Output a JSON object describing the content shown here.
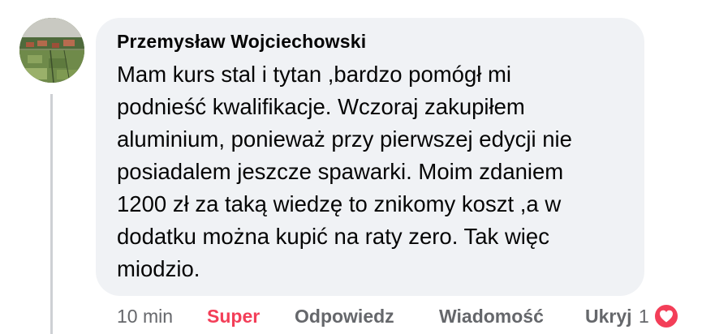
{
  "comment": {
    "author": "Przemysław Wojciechowski",
    "text": "Mam kurs stal i tytan ,bardzo pomógł mi\npodnieść kwalifikacje.  Wczoraj zakupiłem\naluminium, ponieważ przy pierwszej edycji nie\nposiadalem jeszcze spawarki. Moim zdaniem\n1200 zł za taką wiedzę to znikomy koszt ,a w\ndodatku można kupić na raty zero. Tak więc\nmiodzio."
  },
  "actions": {
    "time": "10 min",
    "reaction_label": "Super",
    "reply_label": "Odpowiedz",
    "message_label": "Wiadomość",
    "hide_label": "Ukryj",
    "reaction_count": "1"
  },
  "icons": {
    "avatar": "avatar-photo",
    "reaction": "heart-icon"
  },
  "colors": {
    "bubble": "#f0f2f5",
    "text": "#050505",
    "secondary": "#65676b",
    "reaction": "#f33e58"
  }
}
